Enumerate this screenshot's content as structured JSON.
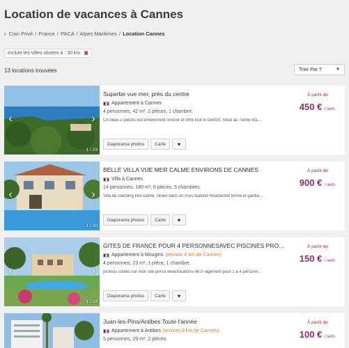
{
  "page": {
    "title": "Location de vacances à Cannes"
  },
  "breadcrumb": {
    "items": [
      "Coin Privé",
      "France",
      "PACA",
      "Alpes Maritimes"
    ],
    "current": "Location Cannes",
    "separator": "/"
  },
  "filter": {
    "label": "Inclure les villes situées à : 30 km",
    "remove_icon": "close-icon"
  },
  "results": {
    "count_label": "13 locations trouvées"
  },
  "sort": {
    "label": "Trier Par ?"
  },
  "listing_buttons": {
    "slideshow": "Diaporama photos",
    "map": "Carte",
    "favorite_icon": "heart-icon"
  },
  "price_prefix": "À partir de",
  "price_unit": "/ sem.",
  "listings": [
    {
      "title": "Superbe vue mer, près du centre",
      "type": "Appartement à Cannes",
      "distance": "",
      "specs": "4 personnes, 42 m², 2 pièces, 1 chambre.",
      "description": "Ce beau 2 pièces est entièrement rénové et offre tout le confort. Situé au 7ième éta...",
      "price": "450 €",
      "photo_counter": "1 / 23"
    },
    {
      "title": "BELLE VILLA VUE MER CALME ENVIRONS DE CANNES",
      "type": "Villa à Cannes",
      "distance": "",
      "specs": "14 personnes, 180 m², 6 pièces, 5 chambres.",
      "description": "Villa de standing très calme, située dans un Parc Naturel Résidentiel fermé et gardie...",
      "price": "900 €",
      "photo_counter": "1 / 20"
    },
    {
      "title": "GITES DE FRANCE POUR 4 PERSONNESAVEC PISCINES PROCHE CA...",
      "type": "Appartement à Mougins",
      "distance": "(environ 6 km de Cannes)",
      "specs": "4 personnes, 23 m², 1 pièce, 1 chambre.",
      "description": "promos soldes sur mon site perso www.locations-06.fr logement pour 1 à 4 personn...",
      "price": "150 €",
      "photo_counter": "1 / 23"
    },
    {
      "title": "Juan-les-Pins/Antibes Toute l'année",
      "type": "Appartement à Antibes",
      "distance": "(environ 9 km de Cannes)",
      "specs": "5 personnes, 29 m², 2 pièces.",
      "description": "",
      "price": "100 €",
      "photo_counter": ""
    }
  ],
  "colors": {
    "price": "#8e2a7a",
    "accent_red": "#c0282d",
    "distance": "#d9822b"
  }
}
